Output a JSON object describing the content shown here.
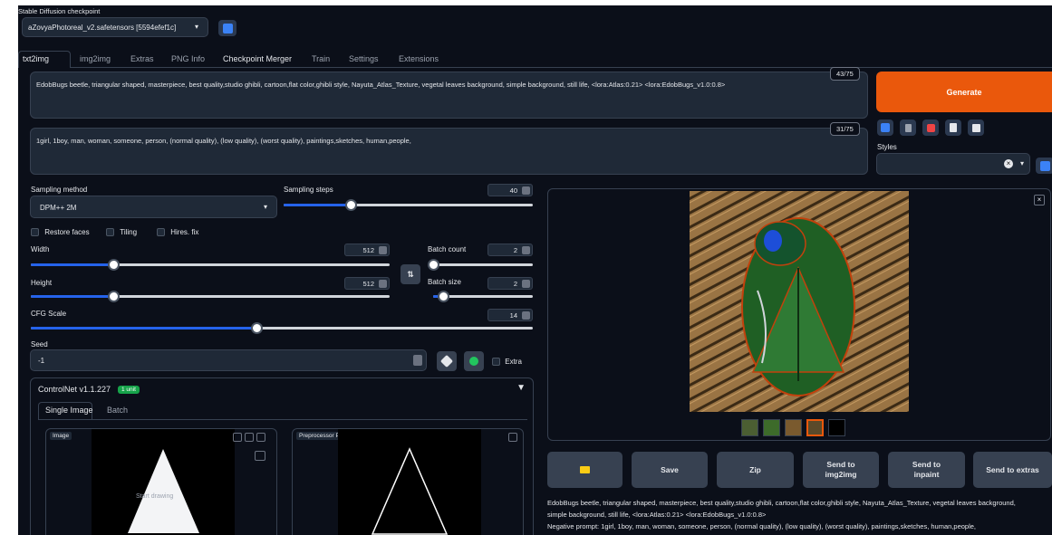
{
  "checkpoint": {
    "label": "Stable Diffusion checkpoint",
    "value": "aZovyaPhotoreal_v2.safetensors [5594efef1c]",
    "refresh_icon": "refresh-icon"
  },
  "tabs": [
    "txt2img",
    "img2img",
    "Extras",
    "PNG Info",
    "Checkpoint Merger",
    "Train",
    "Settings",
    "Extensions"
  ],
  "prompt": {
    "text": "EdobBugs beetle, triangular shaped, masterpiece, best quality,studio ghibli, cartoon,flat color,ghibli style, Nayuta_Atlas_Texture, vegetal leaves background, simple background, still life, <lora:Atlas:0.21> <lora:EdobBugs_v1.0:0.8>",
    "counter": "43/75"
  },
  "negative_prompt": {
    "text": "1girl, 1boy, man, woman, someone, person, (normal quality), (low quality), (worst quality), paintings,sketches, human,people,",
    "counter": "31/75"
  },
  "generate_label": "Generate",
  "styles": {
    "label": "Styles",
    "clear": "×"
  },
  "sampling": {
    "method_label": "Sampling method",
    "method_value": "DPM++ 2M",
    "steps_label": "Sampling steps",
    "steps_value": "40",
    "steps_fraction": 0.27
  },
  "checks": {
    "restore_faces": "Restore faces",
    "tiling": "Tiling",
    "hires": "Hires. fix"
  },
  "width": {
    "label": "Width",
    "value": "512",
    "fraction": 0.23
  },
  "height": {
    "label": "Height",
    "value": "512",
    "fraction": 0.23
  },
  "swap_label": "⇅",
  "batch_count": {
    "label": "Batch count",
    "value": "2",
    "fraction": 0.0
  },
  "batch_size": {
    "label": "Batch size",
    "value": "2",
    "fraction": 0.1
  },
  "cfg": {
    "label": "CFG Scale",
    "value": "14",
    "fraction": 0.45
  },
  "seed": {
    "label": "Seed",
    "value": "-1",
    "extra": "Extra"
  },
  "controlnet": {
    "title": "ControlNet v1.1.227",
    "badge": "1 unit",
    "tabs": [
      "Single Image",
      "Batch"
    ],
    "image_label": "Image",
    "preview_label": "Preprocessor Preview",
    "start_drawing": "Start drawing"
  },
  "output_buttons": [
    "Save",
    "Zip",
    "Send to img2img",
    "Send to inpaint",
    "Send to extras"
  ],
  "info_text": "EdobBugs beetle, triangular shaped, masterpiece, best quality,studio ghibli, cartoon,flat color,ghibli style, Nayuta_Atlas_Texture, vegetal leaves background, simple background, still life, <lora:Atlas:0.21> <lora:EdobBugs_v1.0:0.8>",
  "info_negative": "Negative prompt: 1girl, 1boy, man, woman, someone, person, (normal quality), (low quality), (worst quality), paintings,sketches, human,people,",
  "colors": {
    "accent": "#ea580c",
    "slider": "#2563eb",
    "bg": "#0b0f19",
    "badge": "#16a34a"
  }
}
